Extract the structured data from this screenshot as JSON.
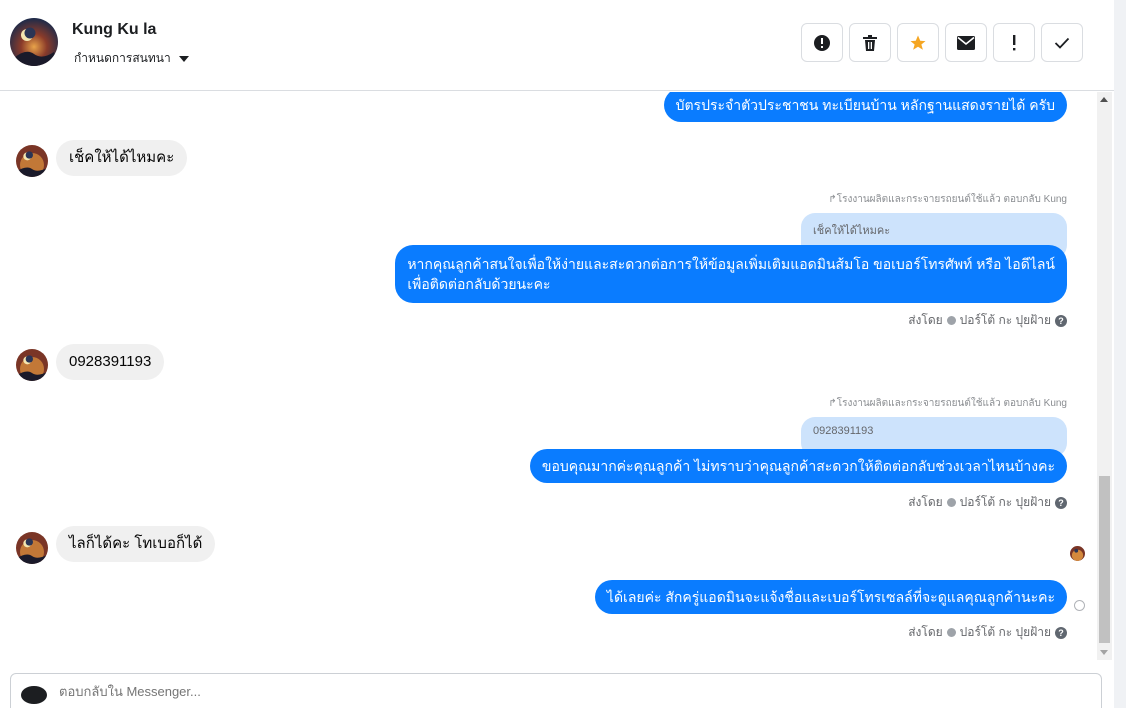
{
  "header": {
    "contact_name": "Kung Ku la",
    "assign_label": "กำหนดการสนทนา",
    "actions": [
      {
        "icon": "alert-circle-icon",
        "label": "Mark as spam"
      },
      {
        "icon": "trash-icon",
        "label": "Delete"
      },
      {
        "icon": "star-icon",
        "label": "Star"
      },
      {
        "icon": "envelope-icon",
        "label": "Mark unread"
      },
      {
        "icon": "exclamation-icon",
        "label": "Follow up"
      },
      {
        "icon": "checkmark-icon",
        "label": "Done"
      }
    ]
  },
  "thread": {
    "msg1_out": "บัตรประจำตัวประชาชน ทะเบียนบ้าน หลักฐานแสดงรายได้ ครับ",
    "msg2_in": "เช็คให้ได้ไหมคะ",
    "reply_note_1": "โรงงานผลิตและกระจายรถยนต์ใช้แล้ว ตอบกลับ Kung",
    "quote_1": "เช็คให้ได้ไหมคะ",
    "msg3_out_line1": "หากคุณลูกค้าสนใจเพื่อให้ง่ายและสะดวกต่อการให้ข้อมูลเพิ่มเติมแอดมินส้มโอ ขอเบอร์โทรศัพท์ หรือ ไอดีไลน์",
    "msg3_out_line2": "เพื่อติดต่อกลับด้วยนะคะ",
    "sent_by_1": {
      "prefix": "ส่งโดย",
      "name": "ปอร์โต้ กะ ปุยฝ้าย",
      "help": "?"
    },
    "msg4_in": "0928391193",
    "reply_note_2": "โรงงานผลิตและกระจายรถยนต์ใช้แล้ว ตอบกลับ Kung",
    "quote_2": "0928391193",
    "msg5_out": "ขอบคุณมากค่ะคุณลูกค้า ไม่ทราบว่าคุณลูกค้าสะดวกให้ติดต่อกลับช่วงเวลาไหนบ้างคะ",
    "sent_by_2": {
      "prefix": "ส่งโดย",
      "name": "ปอร์โต้ กะ ปุยฝ้าย",
      "help": "?"
    },
    "msg6_in": "ไลก็ได้คะ โทเบอก็ได้",
    "msg7_out": "ได้เลยค่ะ สักครู่แอดมินจะแจ้งชื่อและเบอร์โทรเซลล์ที่จะดูแลคุณลูกค้านะคะ",
    "sent_by_3": {
      "prefix": "ส่งโดย",
      "name": "ปอร์โต้ กะ ปุยฝ้าย",
      "help": "?"
    }
  },
  "composer": {
    "placeholder": "ตอบกลับใน Messenger..."
  },
  "colors": {
    "outgoing_bubble": "#0a7cff",
    "incoming_bubble": "#f0f0f0",
    "quote_bubble": "#cde3fc",
    "star": "#f5a623"
  }
}
